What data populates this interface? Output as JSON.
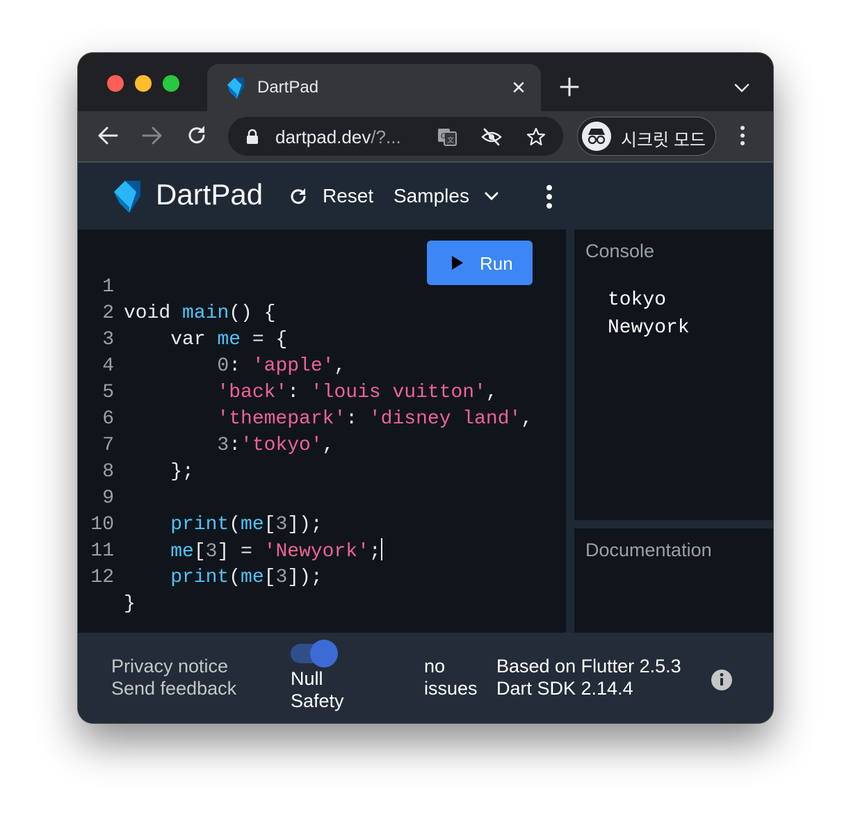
{
  "browser": {
    "tab": {
      "title": "DartPad",
      "close_glyph": "✕",
      "icon": "dart-logo-icon"
    },
    "address": {
      "url_main": "dartpad.dev",
      "url_rest": "/?..."
    },
    "profile_label": "시크릿 모드"
  },
  "app": {
    "title": "DartPad",
    "reset_label": "Reset",
    "samples_label": "Samples",
    "run_label": "Run"
  },
  "editor": {
    "line_numbers": [
      "1",
      "2",
      "3",
      "4",
      "5",
      "6",
      "7",
      "8",
      "9",
      "10",
      "11",
      "12"
    ],
    "code_lines": [
      "void main() {",
      "    var me = {",
      "        0: 'apple',",
      "        'back': 'louis vuitton',",
      "        'themepark': 'disney land',",
      "        3:'tokyo',",
      "    };",
      "",
      "    print(me[3]);",
      "    me[3] = 'Newyork';",
      "    print(me[3]);",
      "}"
    ]
  },
  "console": {
    "title": "Console",
    "output": [
      "tokyo",
      "Newyork"
    ]
  },
  "documentation": {
    "title": "Documentation"
  },
  "footer": {
    "privacy_label": "Privacy notice",
    "feedback_label": "Send feedback",
    "null_safety_line1": "Null",
    "null_safety_line2": "Safety",
    "null_safety_enabled": true,
    "issues_line1": "no",
    "issues_line2": "issues",
    "flutter_version": "Based on Flutter 2.5.3",
    "dart_sdk_version": "Dart SDK 2.14.4"
  },
  "colors": {
    "accent": "#3d86f5",
    "header_bg": "#1e2935",
    "editor_bg": "#10151c",
    "string": "#f06292",
    "identifier": "#4fc3f7"
  }
}
